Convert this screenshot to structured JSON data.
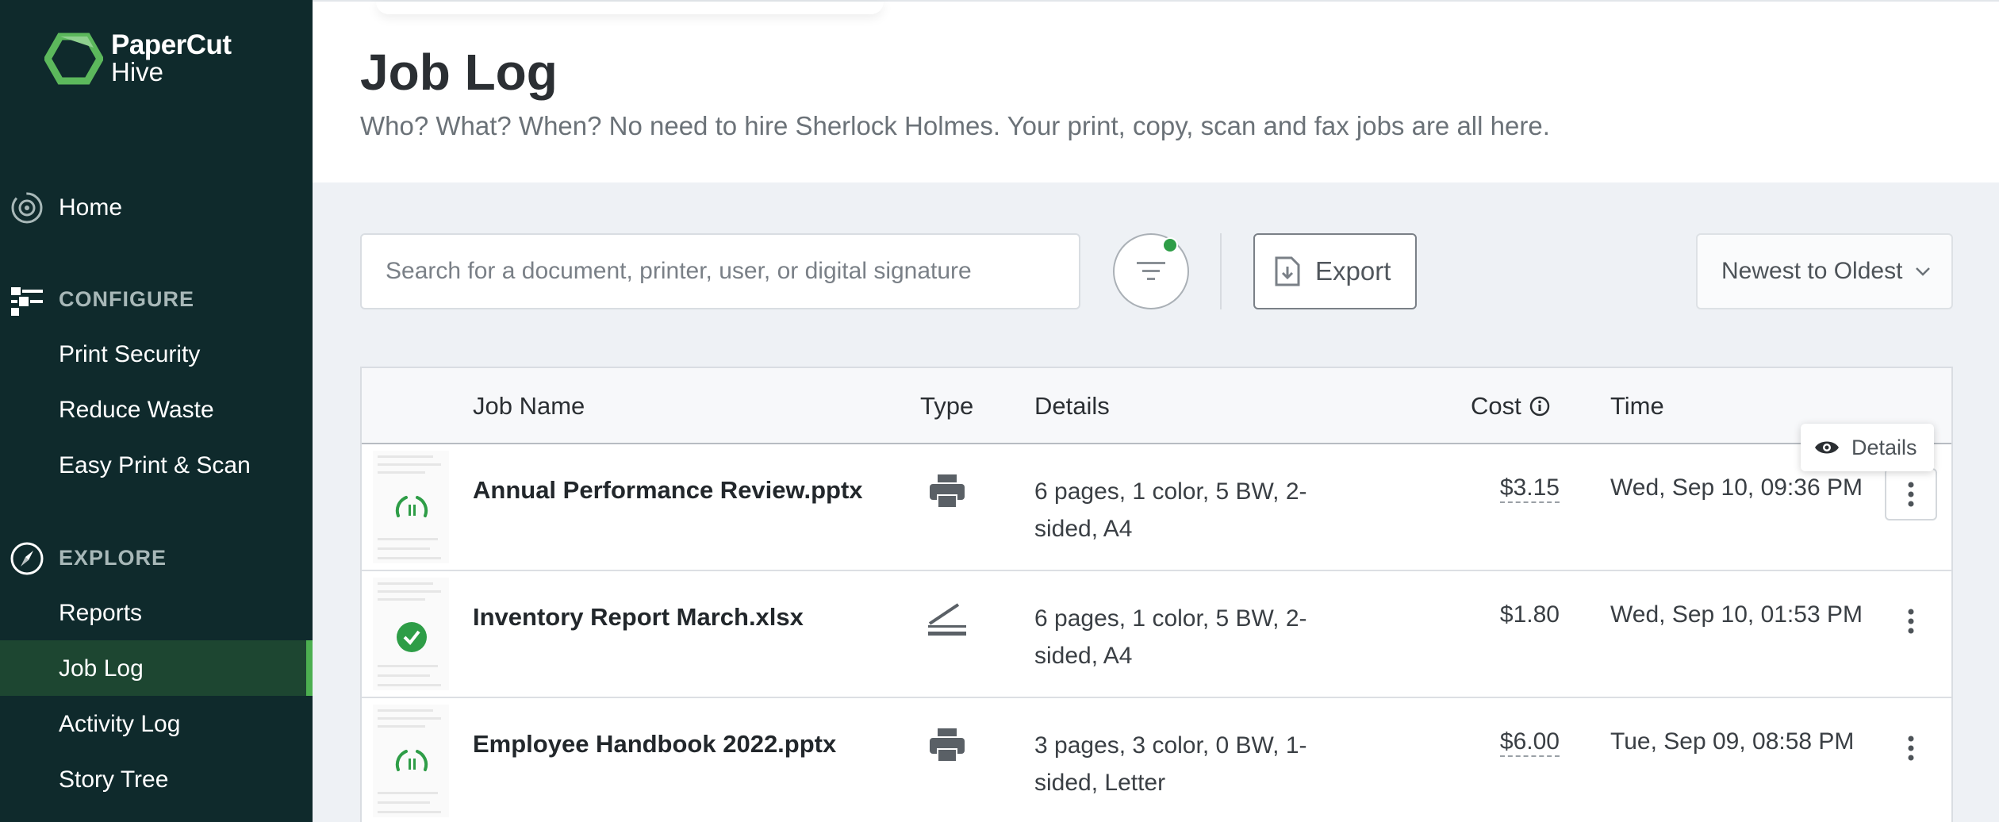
{
  "app": {
    "brand_line1": "PaperCut",
    "brand_line2": "Hive"
  },
  "sidebar": {
    "home": "Home",
    "configure_label": "CONFIGURE",
    "configure_items": [
      "Print Security",
      "Reduce Waste",
      "Easy Print & Scan"
    ],
    "explore_label": "EXPLORE",
    "explore_items": [
      "Reports",
      "Job Log",
      "Activity Log",
      "Story Tree"
    ],
    "active_item": "Job Log",
    "accent_color": "#4caf50"
  },
  "header": {
    "title": "Job Log",
    "subtitle": "Who? What? When? No need to hire Sherlock Holmes. Your print, copy, scan and fax jobs are all here."
  },
  "toolbar": {
    "search_placeholder": "Search for a document, printer, user, or digital signature",
    "search_value": "",
    "filter_icon": "filter-icon",
    "filter_active": true,
    "export_label": "Export",
    "sort_selected": "Newest to Oldest"
  },
  "table": {
    "columns": [
      "Job Name",
      "Type",
      "Details",
      "Cost",
      "Time"
    ],
    "rows": [
      {
        "status": "in-progress",
        "job_name": "Annual Performance Review.pptx",
        "type": "print",
        "details": "6 pages, 1 color, 5 BW, 2-sided, A4",
        "cost": "$3.15",
        "time": "Wed, Sep 10, 09:36 PM"
      },
      {
        "status": "completed",
        "job_name": "Inventory Report March.xlsx",
        "type": "scan",
        "details": "6 pages, 1 color, 5 BW, 2-sided, A4",
        "cost": "$1.80",
        "time": "Wed, Sep 10, 01:53 PM"
      },
      {
        "status": "in-progress",
        "job_name": "Employee Handbook 2022.pptx",
        "type": "print",
        "details": "3 pages, 3 color, 0 BW, 1-sided, Letter",
        "cost": "$6.00",
        "time": "Tue, Sep 09, 08:58 PM"
      }
    ]
  },
  "tooltip": {
    "label": "Details",
    "icon": "eye-icon"
  }
}
